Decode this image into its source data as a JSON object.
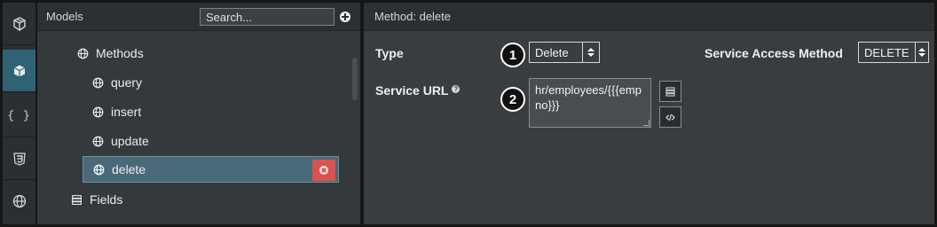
{
  "sidebar": {
    "models_title": "Models",
    "search_placeholder": "Search...",
    "tree": {
      "methods_label": "Methods",
      "items": [
        "query",
        "insert",
        "update",
        "delete"
      ],
      "fields_label": "Fields"
    }
  },
  "rail": {
    "items": [
      "cube-icon",
      "model-icon",
      "curly-braces-icon",
      "css-icon",
      "globe-icon"
    ],
    "braces_text": "{ }"
  },
  "method_panel": {
    "title": "Method: delete",
    "type_label": "Type",
    "type_value": "Delete",
    "access_label": "Service Access Method",
    "access_value": "DELETE",
    "url_label": "Service URL",
    "help_glyph": "?",
    "url_value": "hr/employees/{{{empno}}}"
  },
  "callouts": [
    "1",
    "2"
  ],
  "colors": {
    "accent": "#2f6275",
    "selected_row": "#4a6a7a",
    "delete_button": "#d9534f"
  }
}
